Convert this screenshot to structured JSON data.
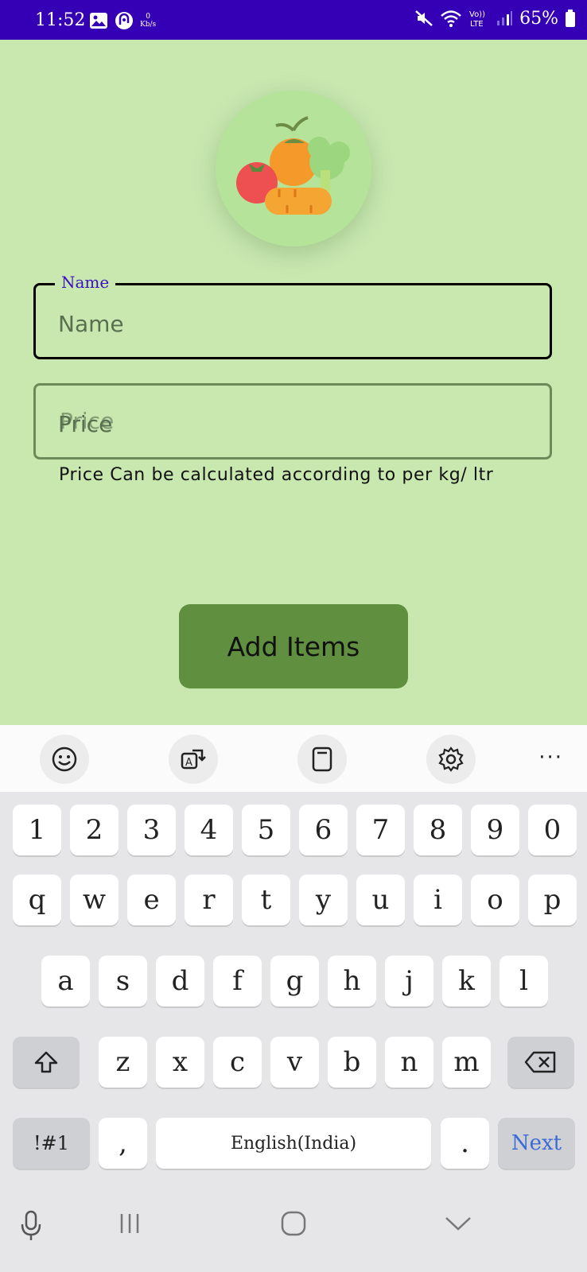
{
  "status_bar": {
    "time": "11:52",
    "speed_value": "0",
    "speed_unit": "Kb/s",
    "battery": "65%",
    "network": "LTE"
  },
  "app": {
    "logo_icon": "vegetables-icon",
    "name_field": {
      "label": "Name",
      "placeholder": "Name",
      "value": ""
    },
    "price_field": {
      "placeholder": "Price",
      "value": ""
    },
    "helper_text": "Price Can be calculated according to per kg/ ltr",
    "add_button": "Add Items",
    "colors": {
      "background": "#c8e8b0",
      "button": "#5f8f3f",
      "status_bar": "#3500b5",
      "focus_label": "#3a10c2"
    }
  },
  "keyboard": {
    "toolbar": [
      "emoji-icon",
      "translate-icon",
      "clipboard-icon",
      "settings-icon",
      "more-icon"
    ],
    "more_label": "···",
    "row_numbers": [
      "1",
      "2",
      "3",
      "4",
      "5",
      "6",
      "7",
      "8",
      "9",
      "0"
    ],
    "row1": [
      "q",
      "w",
      "e",
      "r",
      "t",
      "y",
      "u",
      "i",
      "o",
      "p"
    ],
    "row2": [
      "a",
      "s",
      "d",
      "f",
      "g",
      "h",
      "j",
      "k",
      "l"
    ],
    "row3": [
      "z",
      "x",
      "c",
      "v",
      "b",
      "n",
      "m"
    ],
    "symbols": "!#1",
    "comma": ",",
    "space": "English(India)",
    "period": ".",
    "action": "Next"
  },
  "navbar": [
    "mic-icon",
    "recents-icon",
    "home-icon",
    "back-icon"
  ]
}
